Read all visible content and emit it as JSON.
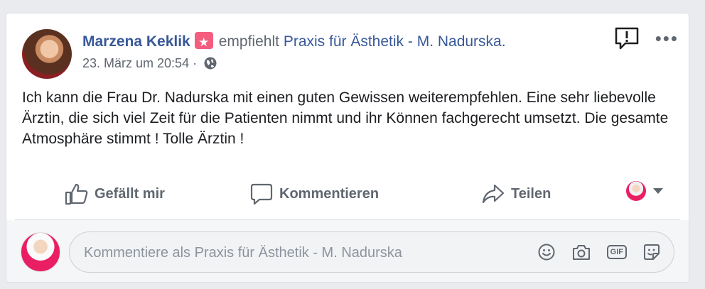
{
  "post": {
    "author": "Marzena Keklik",
    "action": "empfiehlt",
    "page": "Praxis für Ästhetik - M. Nadurska.",
    "timestamp": "23. März um 20:54 ·",
    "privacy_icon": "globe-icon",
    "text": "Ich kann die Frau Dr. Nadurska mit einen guten Gewissen weiterempfehlen. Eine sehr liebevolle Ärztin, die sich viel Zeit für die Patienten nimmt und ihr Können fachgerecht umsetzt. Die gesamte Atmosphäre stimmt ! Tolle Ärztin !"
  },
  "actions": {
    "like": "Gefällt mir",
    "comment": "Kommentieren",
    "share": "Teilen"
  },
  "comment_box": {
    "placeholder": "Kommentiere als Praxis für Ästhetik - M. Nadurska"
  },
  "colors": {
    "author": "#385898",
    "badge": "#f45d7e",
    "muted": "#606770",
    "background": "#e9ebee"
  },
  "icons": [
    "recommend-badge-icon",
    "report-icon",
    "more-icon",
    "like-icon",
    "comment-icon",
    "share-icon",
    "emoji-icon",
    "camera-icon",
    "gif-icon",
    "sticker-icon"
  ]
}
